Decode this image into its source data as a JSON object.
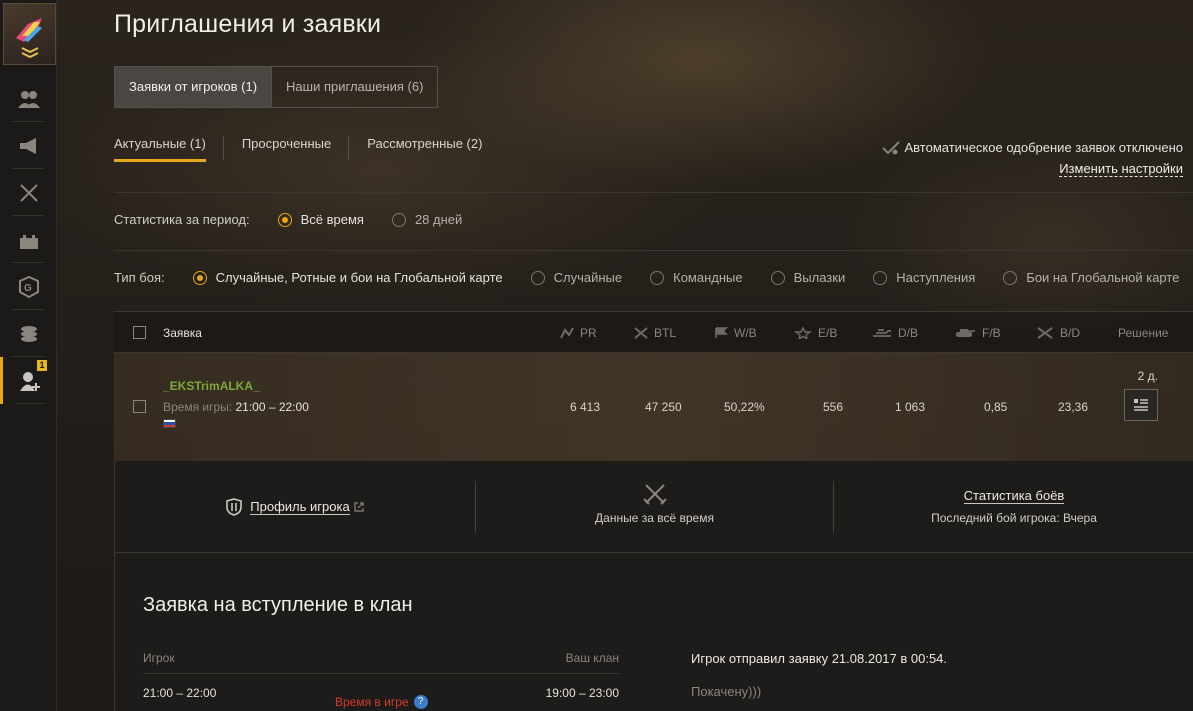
{
  "page_title": "Приглашения и заявки",
  "tabs": [
    {
      "label": "Заявки от игроков (1)",
      "active": true
    },
    {
      "label": "Наши приглашения (6)",
      "active": false
    }
  ],
  "subtabs": [
    {
      "label": "Актуальные (1)",
      "active": true
    },
    {
      "label": "Просроченные",
      "active": false
    },
    {
      "label": "Рассмотренные (2)",
      "active": false
    }
  ],
  "auto_approve": {
    "status": "Автоматическое одобрение заявок отключено",
    "change_label": "Изменить настройки"
  },
  "period": {
    "label": "Статистика за период:",
    "options": [
      {
        "label": "Всё время",
        "selected": true
      },
      {
        "label": "28 дней",
        "selected": false
      }
    ]
  },
  "battle_type": {
    "label": "Тип боя:",
    "options": [
      {
        "label": "Случайные, Ротные и бои на Глобальной карте",
        "selected": true
      },
      {
        "label": "Случайные",
        "selected": false
      },
      {
        "label": "Командные",
        "selected": false
      },
      {
        "label": "Вылазки",
        "selected": false
      },
      {
        "label": "Наступления",
        "selected": false
      },
      {
        "label": "Бои на Глобальной карте",
        "selected": false
      }
    ]
  },
  "table": {
    "headers": {
      "name": "Заявка",
      "pr": "PR",
      "btl": "BTL",
      "wb": "W/B",
      "eb": "E/B",
      "db": "D/B",
      "fb": "F/B",
      "bd": "B/D",
      "decision": "Решение"
    },
    "row": {
      "player": "_EKSTrimALKA_",
      "play_time_label": "Время игры:",
      "play_time": "21:00 – 22:00",
      "pr": "6 413",
      "btl": "47 250",
      "wb": "50,22%",
      "eb": "556",
      "db": "1 063",
      "fb": "0,85",
      "bd": "23,36",
      "days": "2 д."
    }
  },
  "details": {
    "profile_link": "Профиль игрока",
    "all_time": "Данные за всё время",
    "battle_stats": "Статистика боёв",
    "last_battle": "Последний бой игрока: Вчера"
  },
  "claim": {
    "title": "Заявка на вступление в клан",
    "player_col": "Игрок",
    "clan_col": "Ваш клан",
    "player_time": "21:00 – 22:00",
    "clan_time": "19:00 – 23:00",
    "time_label": "Время в игре",
    "sent": "Игрок отправил заявку 21.08.2017 в 00:54.",
    "message": "Покачену)))"
  },
  "colors": {
    "accent": "#e8a71a",
    "player_name": "#7da83b",
    "time_warning": "#d23a2a"
  }
}
